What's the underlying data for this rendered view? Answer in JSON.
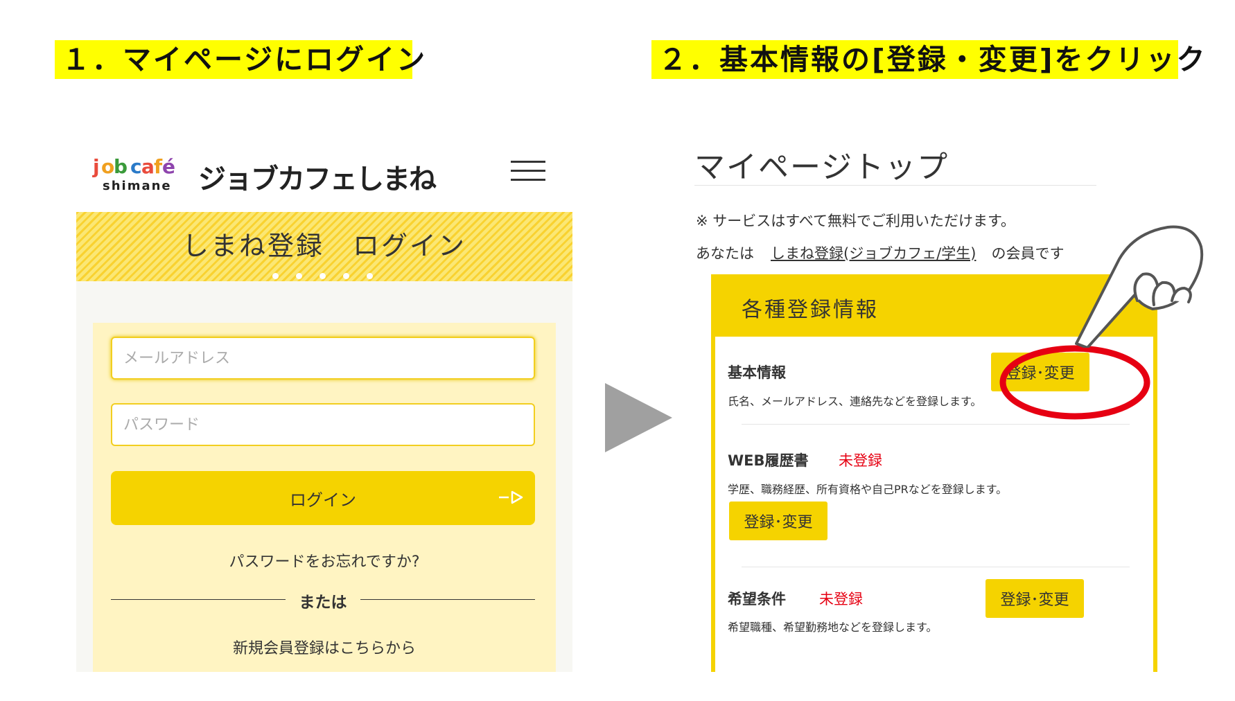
{
  "steps": {
    "step1": "１．マイページにログイン",
    "step2": "２．基本情報の[登録・変更]をクリック"
  },
  "login": {
    "logo_alt_text": "job café shimane",
    "logo_text": "ジョブカフェしまね",
    "banner_title": "しまね登録　ログイン",
    "email_placeholder": "メールアドレス",
    "password_placeholder": "パスワード",
    "login_label": "ログイン",
    "forgot_label": "パスワードをお忘れですか?",
    "or_label": "または",
    "signup_label": "新規会員登録はこちらから"
  },
  "mypage": {
    "title": "マイページトップ",
    "notice": "※ サービスはすべて無料でご利用いただけます。",
    "member_prefix": "あなたは",
    "member_link": "しまね登録(ジョブカフェ/学生)",
    "member_suffix": "の会員です",
    "card_title": "各種登録情報",
    "sections": [
      {
        "title": "基本情報",
        "status": "",
        "desc": "氏名、メールアドレス、連絡先などを登録します。",
        "button": "登録･変更"
      },
      {
        "title": "WEB履歴書",
        "status": "未登録",
        "desc": "学歴、職務経歴、所有資格や自己PRなどを登録します。",
        "button": "登録･変更"
      },
      {
        "title": "希望条件",
        "status": "未登録",
        "desc": "希望職種、希望勤務地などを登録します。",
        "button": "登録･変更"
      }
    ]
  },
  "icons": {
    "menu": "hamburger-icon",
    "login_arrow": "arrow-right-icon",
    "next": "play-triangle-icon",
    "pointer": "pointing-hand-icon",
    "highlight": "red-circle-highlight"
  },
  "colors": {
    "step_highlight": "#ffff00",
    "brand_yellow": "#f5d300",
    "form_bg": "#fff4c2",
    "unregistered": "#e60012",
    "highlight_ring": "#e60012"
  }
}
